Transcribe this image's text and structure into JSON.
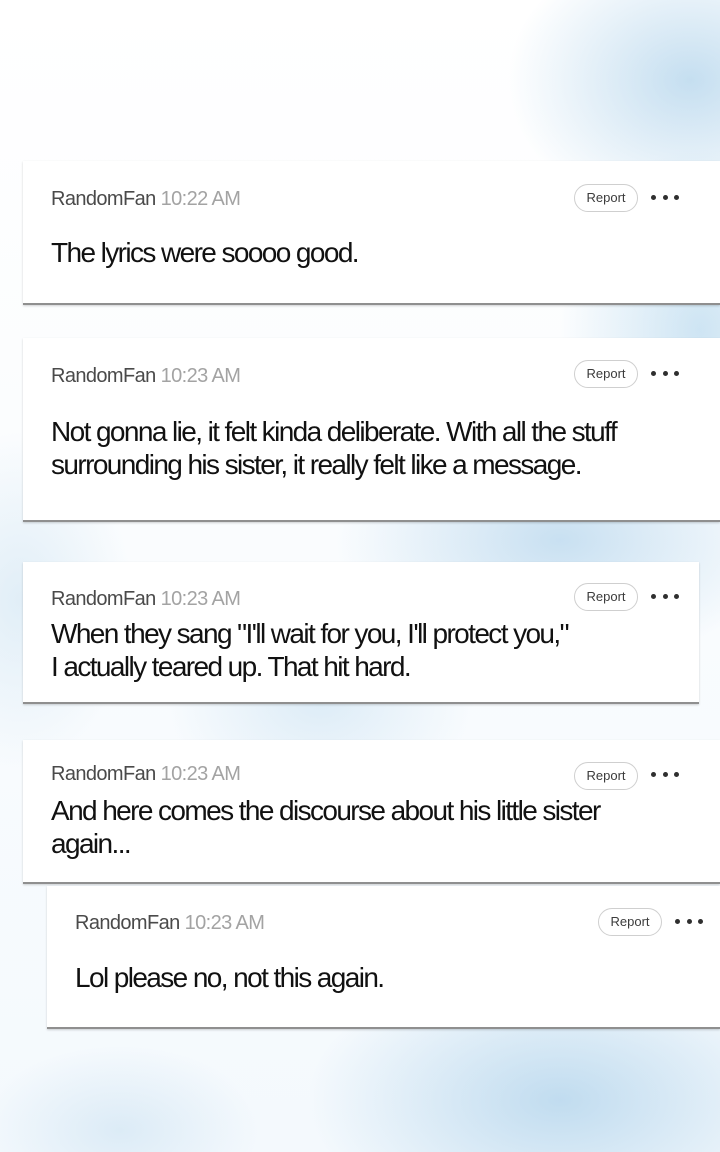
{
  "report_label": "Report",
  "comments": [
    {
      "username": "RandomFan",
      "time": "10:22 AM",
      "lines": [
        "The lyrics were soooo good."
      ]
    },
    {
      "username": "RandomFan",
      "time": "10:23 AM",
      "lines": [
        "Not gonna lie, it felt kinda deliberate. With all the stuff",
        "surrounding his sister, it really felt like a message."
      ]
    },
    {
      "username": "RandomFan",
      "time": "10:23 AM",
      "lines": [
        "When they sang \"I'll wait for you, I'll protect you,\"",
        "I actually teared up. That hit hard."
      ]
    },
    {
      "username": "RandomFan",
      "time": "10:23 AM",
      "lines": [
        "And here comes the discourse about his little sister",
        "again..."
      ]
    },
    {
      "username": "RandomFan",
      "time": "10:23 AM",
      "lines": [
        "Lol please no, not this again."
      ],
      "is_reply": true
    }
  ]
}
